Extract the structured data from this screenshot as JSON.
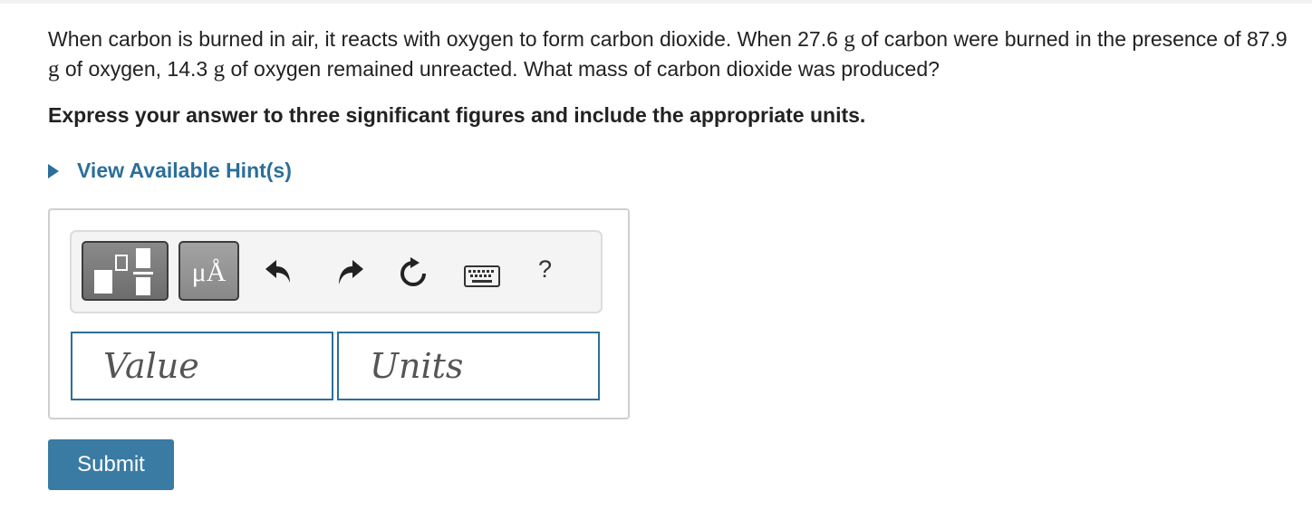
{
  "question": {
    "part1": "When carbon is burned in air, it reacts with oxygen to form carbon dioxide. When 27.6 ",
    "unit1": "g",
    "part2": " of carbon were burned in the presence of 87.9 ",
    "unit2": "g",
    "part3": " of oxygen, 14.3 ",
    "unit3": "g",
    "part4": "  of oxygen remained unreacted. What mass of carbon dioxide was produced?"
  },
  "instruction": "Express your answer to three significant figures and include the appropriate units.",
  "hint": {
    "label": "View Available Hint(s)",
    "icon": "caret-right-icon"
  },
  "toolbar": {
    "units_button_label": "μÅ",
    "help_label": "?",
    "icons": [
      "templates-icon",
      "units-icon",
      "undo-icon",
      "redo-icon",
      "reset-icon",
      "keyboard-icon",
      "help-icon"
    ]
  },
  "answer": {
    "value_placeholder": "Value",
    "units_placeholder": "Units"
  },
  "submit_label": "Submit",
  "colors": {
    "accent": "#2c6f9a",
    "submit_bg": "#3a7ba3",
    "button_dark": "#6d6d6d"
  }
}
